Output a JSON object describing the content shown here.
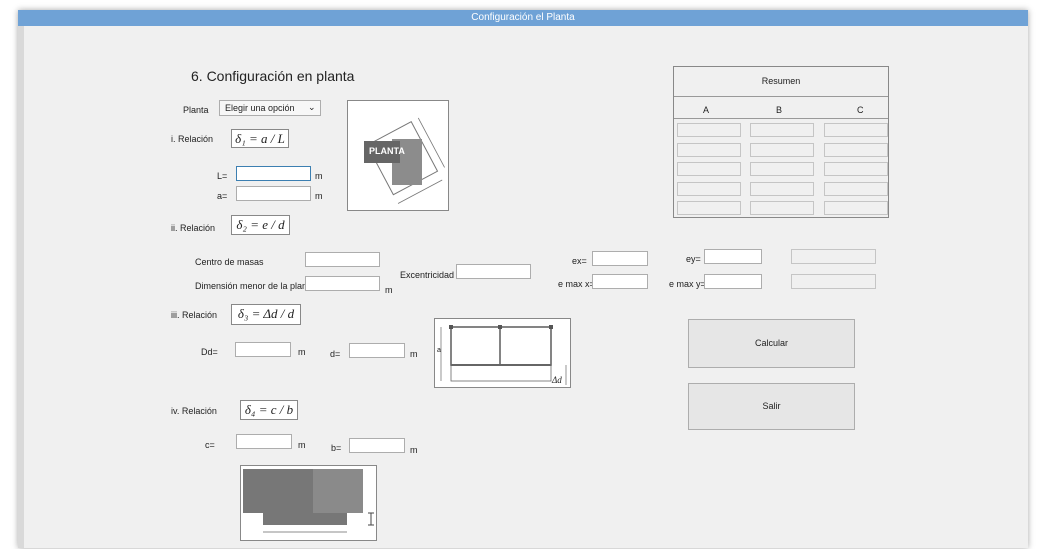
{
  "window": {
    "title": "Configuración el Planta"
  },
  "heading": "6. Configuración en planta",
  "planta": {
    "label": "Planta",
    "select_value": "Elegir una opción"
  },
  "image_planta_text": "PLANTA",
  "rel1": {
    "label": "i. Relación",
    "formula": "δ₁ = a / L",
    "L_label": "L=",
    "a_label": "a=",
    "unit": "m"
  },
  "rel2": {
    "label": "ii. Relación",
    "formula": "δ₂ = e / d",
    "centro_masas": "Centro de masas",
    "dimension_menor": "Dimensión menor de la planta",
    "unit": "m",
    "excentricidad": "Excentricidad",
    "ex": "ex=",
    "ey": "ey=",
    "emaxx": "e max x=",
    "emaxy": "e max y="
  },
  "rel3": {
    "label": "iii. Relación",
    "formula": "δ₃ = Δd / d",
    "Dd_label": "Dd=",
    "d_label": "d=",
    "unit": "m"
  },
  "rel4": {
    "label": "iv. Relación",
    "formula": "δ₄ = c / b",
    "c_label": "c=",
    "b_label": "b=",
    "unit": "m"
  },
  "resumen": {
    "title": "Resumen",
    "columns": [
      "A",
      "B",
      "C"
    ]
  },
  "buttons": {
    "calcular": "Calcular",
    "salir": "Salir"
  },
  "diagram_labels": {
    "delta_d": "Δd",
    "small_letter": "a"
  }
}
